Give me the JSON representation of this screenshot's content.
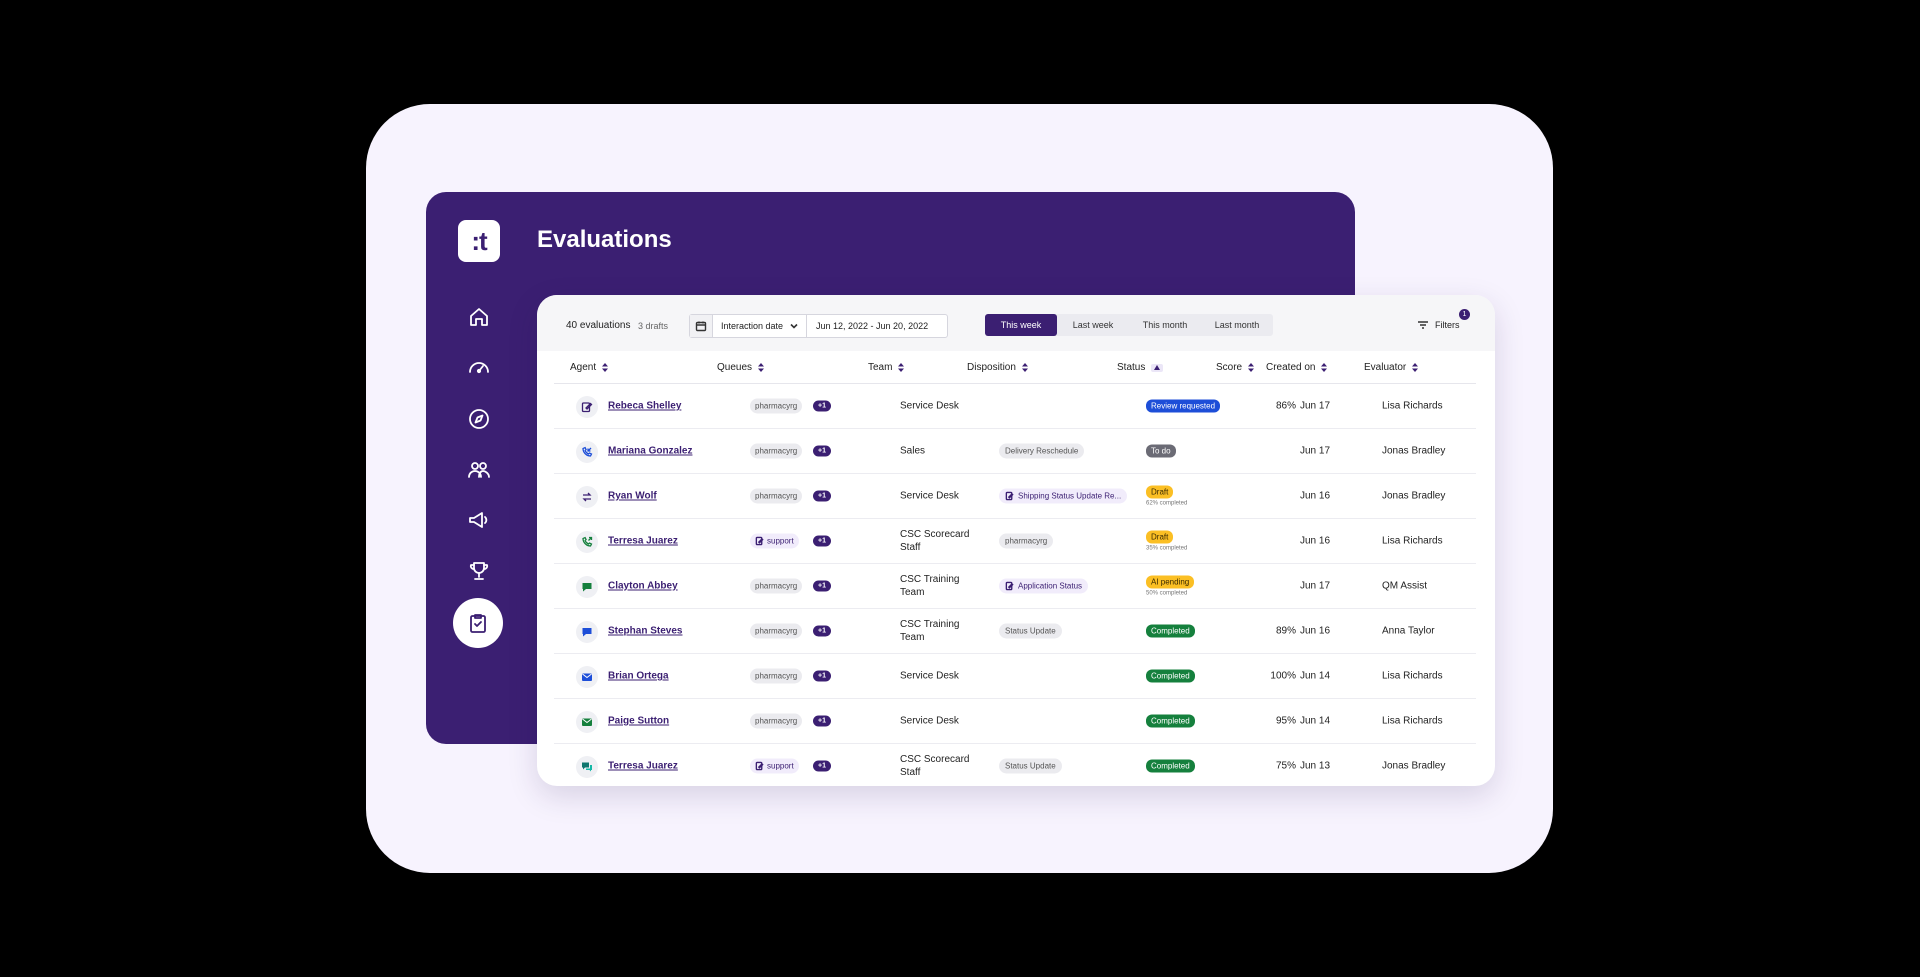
{
  "header": {
    "logo_text": ":t",
    "title": "Evaluations"
  },
  "sidebar": {
    "items": [
      {
        "icon": "home-icon"
      },
      {
        "icon": "dashboard-gauge-icon"
      },
      {
        "icon": "compass-icon"
      },
      {
        "icon": "users-icon"
      },
      {
        "icon": "megaphone-icon"
      },
      {
        "icon": "trophy-icon"
      },
      {
        "icon": "clipboard-check-icon",
        "active": true
      }
    ]
  },
  "toolbar": {
    "evaluation_count": "40 evaluations",
    "drafts": "3 drafts",
    "date_field": "Interaction date",
    "date_range": "Jun 12, 2022 - Jun 20, 2022",
    "periods": [
      "This week",
      "Last week",
      "This month",
      "Last month"
    ],
    "active_period": "This week",
    "filters_label": "Filters",
    "filters_count": "1"
  },
  "table": {
    "columns": [
      "Agent",
      "Queues",
      "Team",
      "Disposition",
      "Status",
      "Score",
      "Created on",
      "Evaluator"
    ],
    "rows": [
      {
        "channel": "edit",
        "agent": "Rebeca Shelley",
        "queue": "pharmacyrg",
        "queue_more": "+1",
        "team": "Service Desk",
        "disposition": "",
        "status": "Review requested",
        "status_color": "#1d4ed8",
        "status_sub": "",
        "score": "86%",
        "created": "Jun 17",
        "evaluator": "Lisa Richards"
      },
      {
        "channel": "call-in",
        "agent": "Mariana Gonzalez",
        "queue": "pharmacyrg",
        "queue_more": "+1",
        "team": "Sales",
        "disposition": "Delivery Reschedule",
        "status": "To do",
        "status_color": "#6b6b75",
        "status_sub": "",
        "score": "",
        "created": "Jun 17",
        "evaluator": "Jonas Bradley"
      },
      {
        "channel": "transfer",
        "agent": "Ryan Wolf",
        "queue": "pharmacyrg",
        "queue_more": "+1",
        "team": "Service Desk",
        "disposition": "Shipping Status Update Re...",
        "disposition_rich": true,
        "status": "Draft",
        "status_color": "#fbbf24",
        "status_text_dark": true,
        "status_sub": "62% completed",
        "score": "",
        "created": "Jun 16",
        "evaluator": "Jonas Bradley"
      },
      {
        "channel": "call-out",
        "agent": "Terresa Juarez",
        "queue": "support",
        "queue_alt": true,
        "queue_more": "+1",
        "team": "CSC Scorecard Staff",
        "disposition": "pharmacyrg",
        "status": "Draft",
        "status_color": "#fbbf24",
        "status_text_dark": true,
        "status_sub": "35% completed",
        "score": "",
        "created": "Jun 16",
        "evaluator": "Lisa Richards"
      },
      {
        "channel": "chat-green",
        "agent": "Clayton Abbey",
        "queue": "pharmacyrg",
        "queue_more": "+1",
        "team": "CSC Training Team",
        "disposition": "Application Status",
        "disposition_rich": true,
        "status": "AI pending",
        "status_color": "#fbbf24",
        "status_text_dark": true,
        "status_sub": "50% completed",
        "score": "",
        "created": "Jun 17",
        "evaluator": "QM Assist"
      },
      {
        "channel": "chat-blue",
        "agent": "Stephan Steves",
        "queue": "pharmacyrg",
        "queue_more": "+1",
        "team": "CSC Training Team",
        "disposition": "Status Update",
        "status": "Completed",
        "status_color": "#15803d",
        "status_sub": "",
        "score": "89%",
        "created": "Jun 16",
        "evaluator": "Anna Taylor"
      },
      {
        "channel": "email-blue",
        "agent": "Brian Ortega",
        "queue": "pharmacyrg",
        "queue_more": "+1",
        "team": "Service Desk",
        "disposition": "",
        "status": "Completed",
        "status_color": "#15803d",
        "status_sub": "",
        "score": "100%",
        "created": "Jun 14",
        "evaluator": "Lisa Richards"
      },
      {
        "channel": "email-green",
        "agent": "Paige Sutton",
        "queue": "pharmacyrg",
        "queue_more": "+1",
        "team": "Service Desk",
        "disposition": "",
        "status": "Completed",
        "status_color": "#15803d",
        "status_sub": "",
        "score": "95%",
        "created": "Jun 14",
        "evaluator": "Lisa Richards"
      },
      {
        "channel": "chat-multi",
        "agent": "Terresa Juarez",
        "queue": "support",
        "queue_alt": true,
        "queue_more": "+1",
        "team": "CSC Scorecard Staff",
        "disposition": "Status Update",
        "status": "Completed",
        "status_color": "#15803d",
        "status_sub": "",
        "score": "75%",
        "created": "Jun 13",
        "evaluator": "Jonas Bradley"
      }
    ]
  },
  "colors": {
    "brand": "#3b1f72",
    "background": "#000000",
    "card": "#f7f3fe"
  }
}
